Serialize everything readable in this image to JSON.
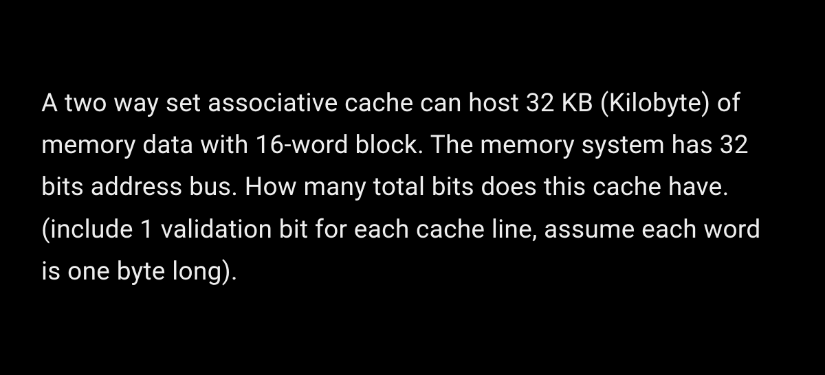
{
  "question": {
    "text": "A two way set associative cache can host 32 KB (Kilobyte) of memory data with 16-word block. The memory system has 32 bits address bus. How many total bits does this cache have. (include 1 validation bit for each cache line, assume each word is one byte long)."
  }
}
